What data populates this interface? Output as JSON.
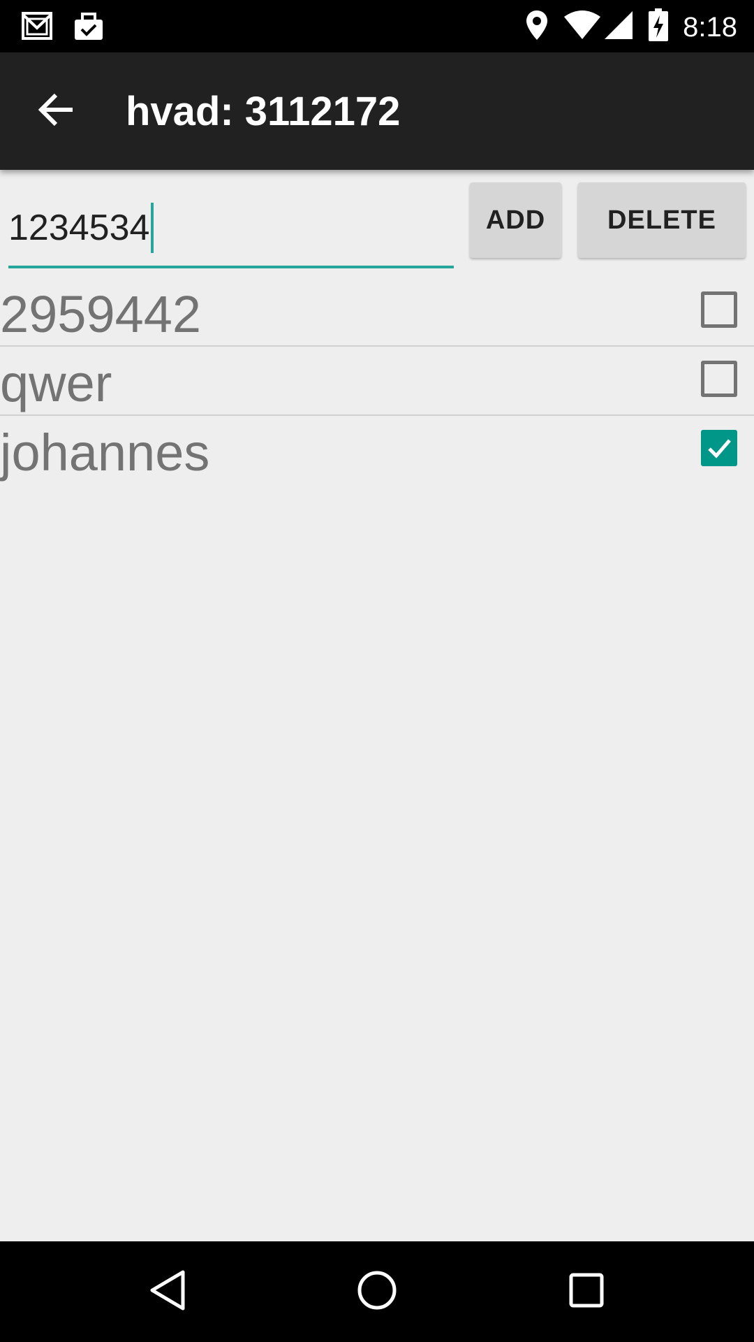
{
  "status_bar": {
    "time": "8:18",
    "left_icons": [
      "gmail-icon",
      "briefcase-check-icon"
    ],
    "right_icons": [
      "location-icon",
      "wifi-icon",
      "signal-icon",
      "battery-charging-icon"
    ]
  },
  "app_bar": {
    "title": "hvad: 3112172",
    "back_icon": "arrow-back-icon"
  },
  "input": {
    "value": "1234534",
    "accent_color": "#26a69a"
  },
  "buttons": {
    "add_label": "ADD",
    "delete_label": "DELETE"
  },
  "list": {
    "items": [
      {
        "label": "2959442",
        "checked": false
      },
      {
        "label": "qwer",
        "checked": false
      },
      {
        "label": "johannes",
        "checked": true
      }
    ],
    "check_color": "#009688"
  },
  "nav_bar": {
    "icons": [
      "back-triangle-icon",
      "home-circle-icon",
      "recents-square-icon"
    ]
  }
}
